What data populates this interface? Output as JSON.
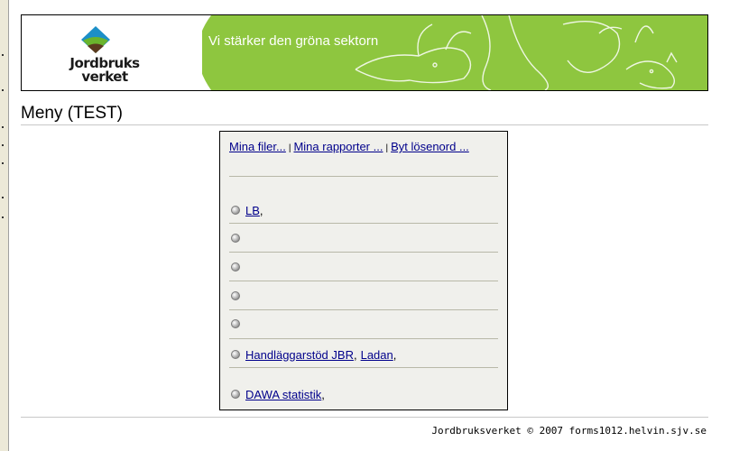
{
  "banner": {
    "logo_line1": "Jordbruks",
    "logo_line2": "verket",
    "slogan": "Vi stärker den gröna sektorn"
  },
  "page": {
    "title": "Meny (TEST)"
  },
  "toplinks": [
    {
      "label": "Mina filer..."
    },
    {
      "label": "Mina rapporter ..."
    },
    {
      "label": "Byt lösenord ..."
    }
  ],
  "separator": "|",
  "menu_rows": [
    {
      "links": [
        "LB"
      ],
      "suffix": ","
    },
    {
      "links": []
    },
    {
      "links": []
    },
    {
      "links": []
    },
    {
      "links": []
    },
    {
      "links": [
        "Handläggarstöd JBR",
        "Ladan"
      ],
      "suffix": ","
    },
    {
      "links": [
        "DAWA statistik"
      ],
      "suffix": ","
    }
  ],
  "row1": {
    "link": "LB",
    "suffix": ","
  },
  "row6": {
    "link1": "Handläggarstöd JBR",
    "comma": ",",
    "link2": "Ladan",
    "suffix": ","
  },
  "row7": {
    "link": "DAWA statistik",
    "suffix": ","
  },
  "footer": {
    "text": "Jordbruksverket © 2007 forms1012.helvin.sjv.se"
  },
  "colors": {
    "banner_green": "#8ec63f",
    "link": "#00008b",
    "menu_bg": "#f0f0ec"
  }
}
